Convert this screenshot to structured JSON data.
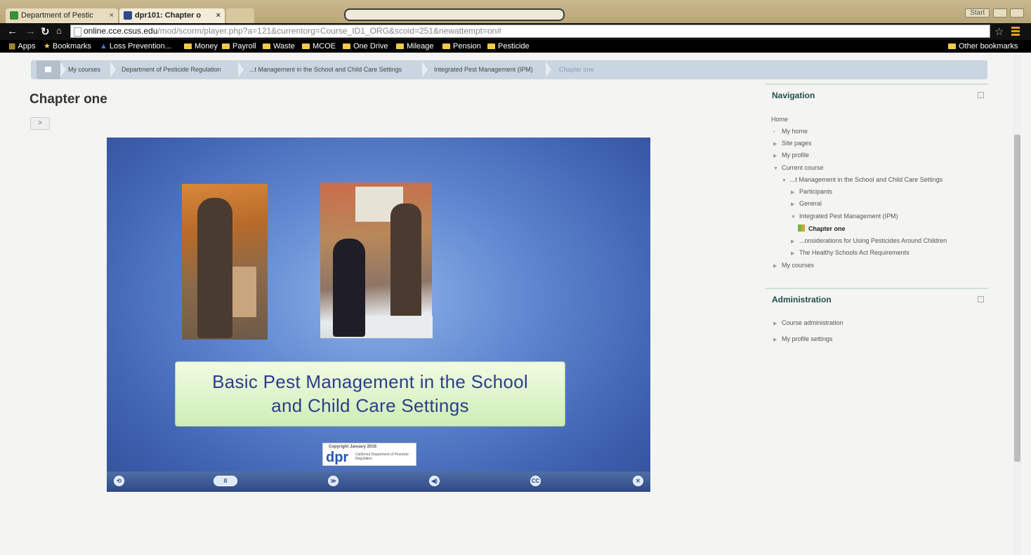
{
  "browser": {
    "tabs": [
      {
        "title": "Department of Pestic",
        "close": "×"
      },
      {
        "title": "dpr101: Chapter o",
        "close": "×"
      }
    ],
    "address": {
      "host": "online.cce.csus.edu",
      "path": "/mod/scorm/player.php?a=121&currentorg=Course_ID1_ORG&scoid=251&newattempt=on#"
    },
    "window_buttons": [
      "Start"
    ],
    "bookmarks": [
      "Apps",
      "Bookmarks",
      "Loss Prevention...",
      "Money",
      "Payroll",
      "Waste",
      "MCOE",
      "One Drive",
      "Mileage",
      "Pension",
      "Pesticide"
    ],
    "other_bookmarks": "Other bookmarks"
  },
  "breadcrumb": [
    "My courses",
    "Department of Pesticide Regulation",
    "...t Management in the School and Child Care Settings",
    "Integrated Pest Management (IPM)",
    "Chapter one"
  ],
  "page": {
    "title": "Chapter one",
    "toc_toggle": ">"
  },
  "player": {
    "slide_title_line1": "Basic Pest Management in the School",
    "slide_title_line2": "and Child Care Settings",
    "logo": {
      "copyright": "Copyright January 2016",
      "mark": "dpr",
      "dept": "California Department of Pesticide Regulation"
    },
    "controls": [
      "⟲",
      "II",
      "≫",
      "◀)",
      "CC",
      "✕"
    ]
  },
  "navigation": {
    "title": "Navigation",
    "items": [
      {
        "label": "Home"
      },
      {
        "label": "My home"
      },
      {
        "label": "Site pages"
      },
      {
        "label": "My profile"
      },
      {
        "label": "Current course"
      },
      {
        "label": "...t Management in the School and Child Care Settings"
      },
      {
        "label": "Participants"
      },
      {
        "label": "General"
      },
      {
        "label": "Integrated Pest Management (IPM)"
      },
      {
        "label": "Chapter one"
      },
      {
        "label": "...onsiderations for Using Pesticides Around Children"
      },
      {
        "label": "The Healthy Schools Act Requirements"
      },
      {
        "label": "My courses"
      }
    ]
  },
  "administration": {
    "title": "Administration",
    "items": [
      {
        "label": "Course administration"
      },
      {
        "label": "My profile settings"
      }
    ]
  }
}
